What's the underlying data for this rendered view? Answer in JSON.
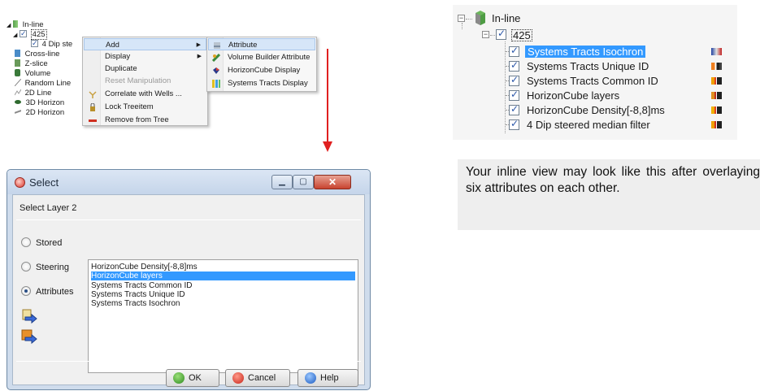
{
  "tree_left": {
    "items": [
      {
        "label": "In-line",
        "icon": "inline-icon"
      },
      {
        "label": "425",
        "icon": "checkbox"
      },
      {
        "label": "4 Dip ste",
        "icon": "checkbox"
      },
      {
        "label": "Cross-line",
        "icon": "crossline-icon"
      },
      {
        "label": "Z-slice",
        "icon": "zslice-icon"
      },
      {
        "label": "Volume",
        "icon": "volume-icon"
      },
      {
        "label": "Random Line",
        "icon": "randomline-icon"
      },
      {
        "label": "2D Line",
        "icon": "2dline-icon"
      },
      {
        "label": "3D Horizon",
        "icon": "3dhorizon-icon"
      },
      {
        "label": "2D Horizon",
        "icon": "2dhorizon-icon"
      }
    ]
  },
  "context_menu": {
    "items": [
      {
        "label": "Add",
        "submenu": true,
        "highlighted": true
      },
      {
        "label": "Display",
        "submenu": true
      },
      {
        "label": "Duplicate"
      },
      {
        "label": "Reset Manipulation",
        "disabled": true
      },
      {
        "label": "Correlate with Wells ..."
      },
      {
        "label": "Lock Treeitem"
      },
      {
        "label": "Remove from Tree"
      }
    ],
    "submenu": [
      {
        "label": "Attribute",
        "highlighted": true
      },
      {
        "label": "Volume Builder Attribute"
      },
      {
        "label": "HorizonCube Display"
      },
      {
        "label": "Systems Tracts Display"
      }
    ]
  },
  "dialog": {
    "title": "Select",
    "heading": "Select Layer 2",
    "sources": [
      {
        "label": "Stored",
        "selected": false
      },
      {
        "label": "Steering",
        "selected": false
      },
      {
        "label": "Attributes",
        "selected": true
      }
    ],
    "list": [
      {
        "label": "HorizonCube Density[-8,8]ms",
        "selected": false
      },
      {
        "label": "HorizonCube layers",
        "selected": true
      },
      {
        "label": "Systems Tracts Common ID",
        "selected": false
      },
      {
        "label": "Systems Tracts Unique ID",
        "selected": false
      },
      {
        "label": "Systems Tracts Isochron",
        "selected": false
      }
    ],
    "buttons": {
      "ok": "OK",
      "cancel": "Cancel",
      "help": "Help"
    }
  },
  "tree_right": {
    "root": "In-line",
    "section": "425",
    "layers": [
      {
        "label": "Systems Tracts Isochron",
        "selected": true
      },
      {
        "label": "Systems Tracts Unique ID",
        "selected": false
      },
      {
        "label": "Systems Tracts Common ID",
        "selected": false
      },
      {
        "label": "HorizonCube layers",
        "selected": false
      },
      {
        "label": "HorizonCube Density[-8,8]ms",
        "selected": false
      },
      {
        "label": "4 Dip steered median filter",
        "selected": false
      }
    ]
  },
  "caption": "Your inline view may look like this after overlaying six attributes on each other.",
  "colors": {
    "selection": "#3399ff",
    "arrow": "#e02020",
    "highlight": "#d6e6f8"
  }
}
